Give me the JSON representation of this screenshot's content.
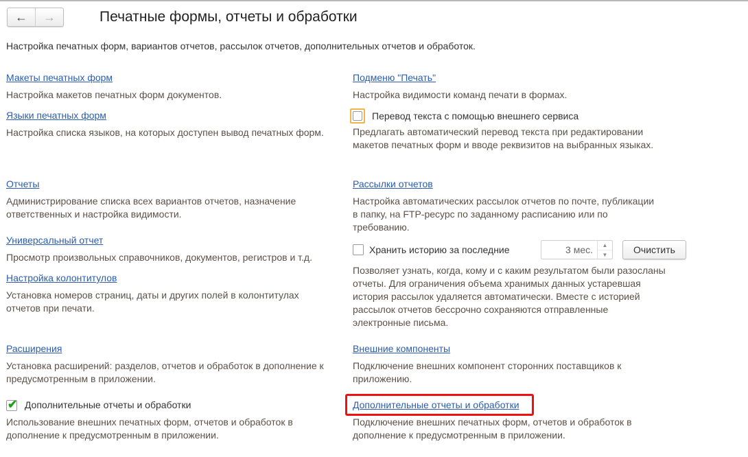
{
  "header": {
    "back": "←",
    "forward": "→",
    "title": "Печатные формы, отчеты и обработки",
    "subtitle": "Настройка печатных форм, вариантов отчетов, рассылок отчетов, дополнительных отчетов и обработок."
  },
  "left": [
    {
      "link": "Макеты печатных форм",
      "desc": "Настройка макетов печатных форм документов."
    },
    {
      "link": "Языки печатных форм",
      "desc": "Настройка списка языков, на которых доступен вывод печатных форм."
    },
    {
      "link": "Отчеты",
      "desc": "Администрирование списка всех вариантов отчетов, назначение ответственных и настройка видимости."
    },
    {
      "link": "Универсальный отчет",
      "desc": "Просмотр произвольных справочников, документов, регистров и т.д."
    },
    {
      "link": "Настройка колонтитулов",
      "desc": "Установка номеров страниц, даты и других полей в колонтитулах отчетов при печати."
    },
    {
      "link": "Расширения",
      "desc": "Установка расширений: разделов, отчетов и обработок в дополнение к предусмотренным в приложении."
    },
    {
      "checkbox": "Дополнительные отчеты и обработки",
      "checked": true,
      "desc": "Использование внешних печатных форм, отчетов и обработок в дополнение к предусмотренным в приложении."
    }
  ],
  "right": [
    {
      "link": "Подменю \"Печать\"",
      "desc": "Настройка видимости команд печати в формах."
    },
    {
      "checkbox": "Перевод текста с помощью внешнего сервиса",
      "checked": false,
      "desc": "Предлагать автоматический перевод текста при редактировании макетов печатных форм и вводе реквизитов на выбранных языках."
    },
    {
      "link": "Рассылки отчетов",
      "desc": "Настройка автоматических рассылок отчетов по почте, публикации в папку, на FTP-ресурс по заданному расписанию или по требованию."
    },
    {
      "checkbox": "Хранить историю за последние",
      "checked": false,
      "value": "3 мес.",
      "button": "Очистить",
      "desc": "Позволяет узнать, когда, кому и с каким результатом были разосланы отчеты. Для ограничения объема хранимых данных устаревшая история рассылок удаляется автоматически. Вместе с историей рассылок отчетов бессрочно сохраняются отправленные электронные письма."
    },
    {
      "link": "Внешние компоненты",
      "desc": "Подключение внешних компонент сторонних поставщиков к приложению."
    },
    {
      "link": "Дополнительные отчеты и обработки",
      "desc": "Подключение внешних печатных форм, отчетов и обработок в дополнение к предусмотренным в приложении."
    }
  ]
}
